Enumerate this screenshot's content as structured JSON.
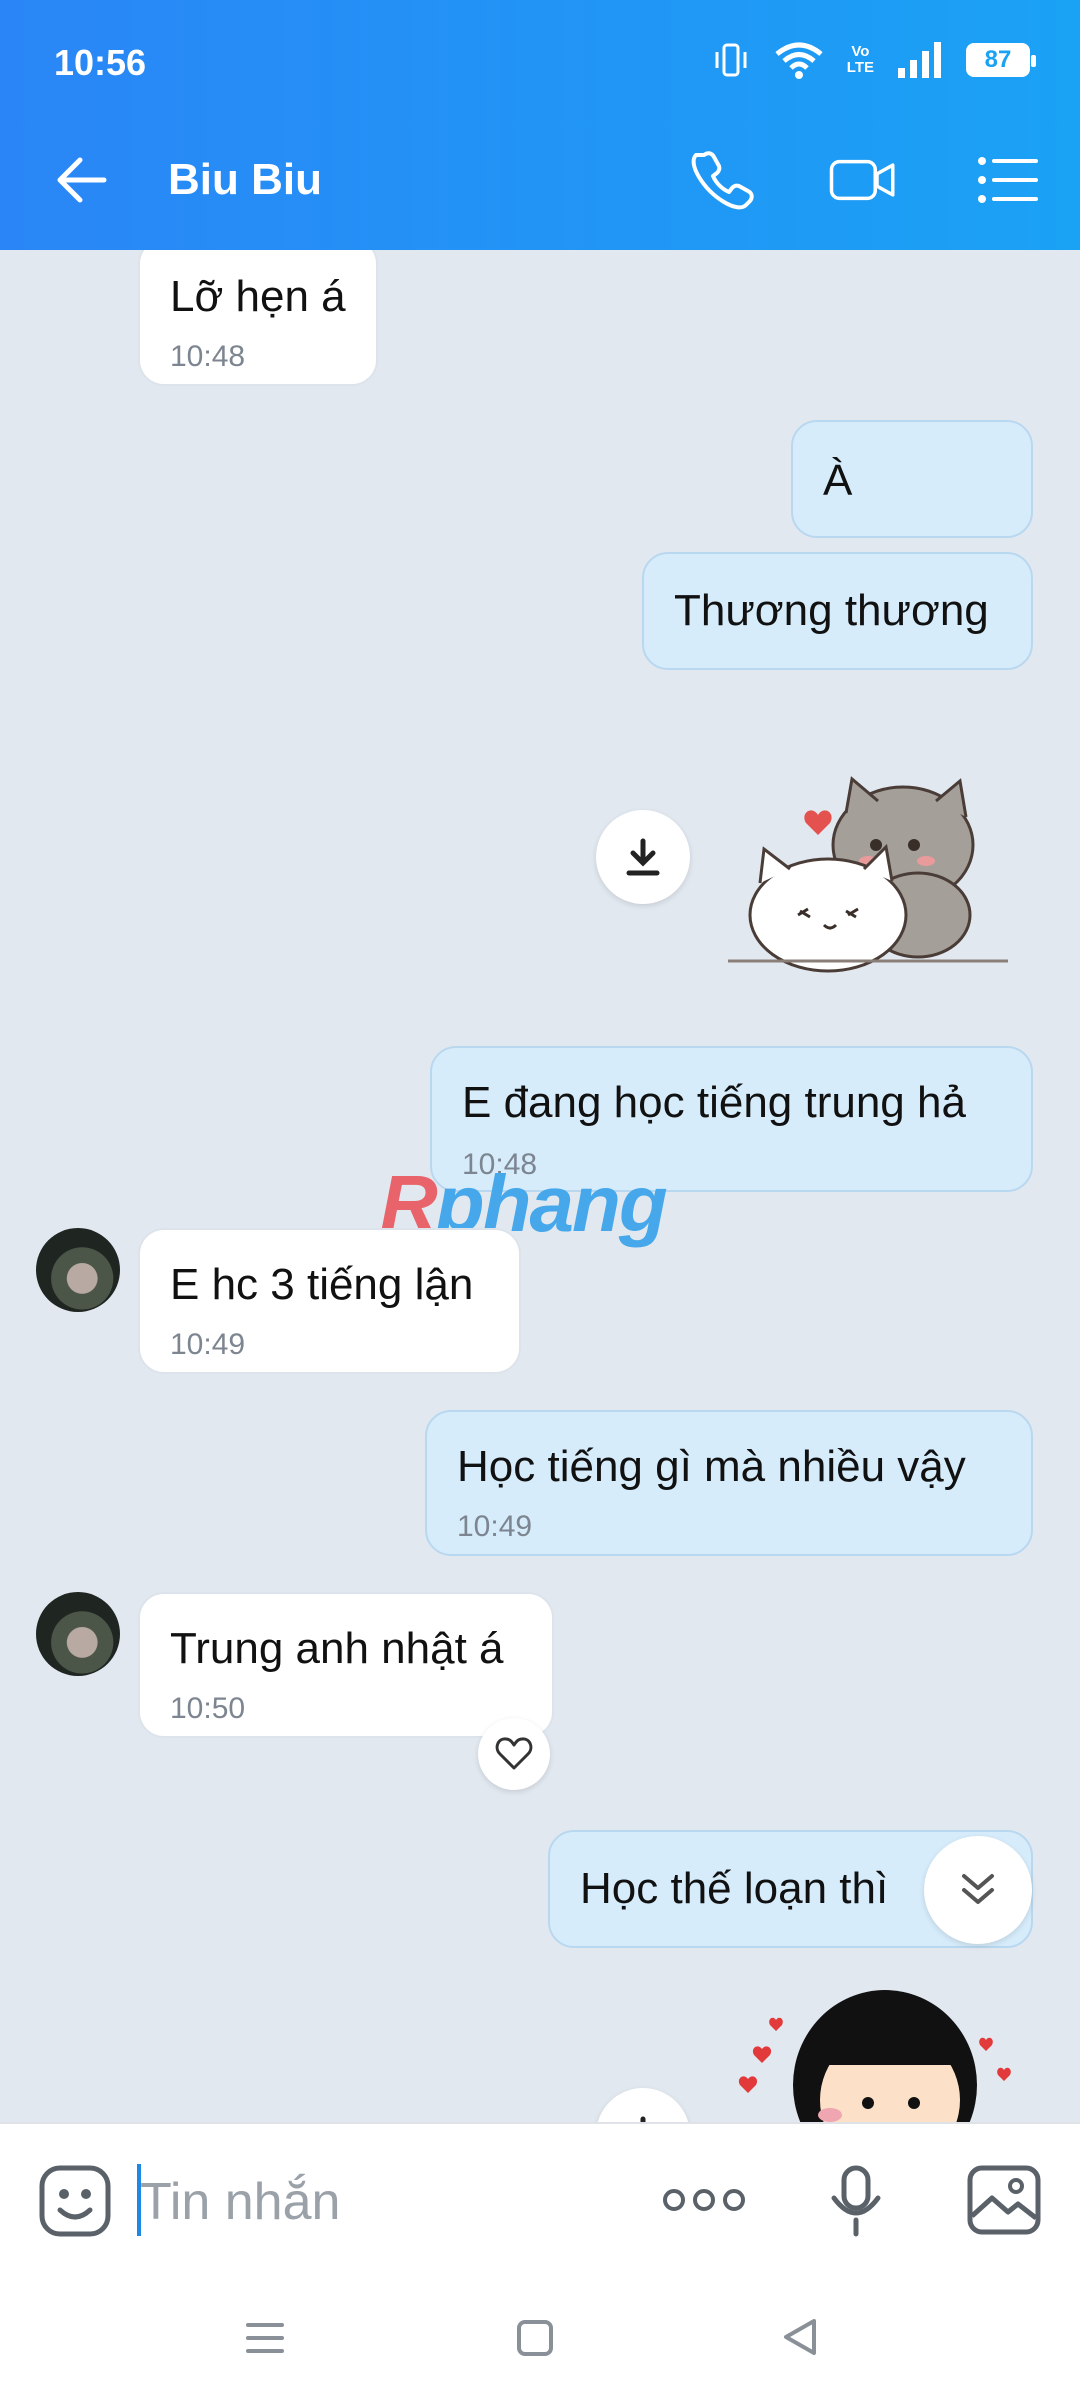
{
  "status": {
    "time": "10:56",
    "battery": "87",
    "volte_top": "Vo",
    "volte_bottom": "LTE"
  },
  "header": {
    "title": "Biu Biu"
  },
  "messages": [
    {
      "side": "received",
      "text": "Lỡ hẹn á",
      "time": "10:48"
    },
    {
      "side": "sent",
      "text": "À"
    },
    {
      "side": "sent",
      "text": "Thương thương"
    },
    {
      "side": "sent",
      "text": "E đang học tiếng trung hả",
      "time": "10:48"
    },
    {
      "side": "received",
      "text": "E hc 3 tiếng lận",
      "time": "10:49"
    },
    {
      "side": "sent",
      "text": "Học tiếng gì mà nhiều vậy",
      "time": "10:49"
    },
    {
      "side": "received",
      "text": "Trung anh nhật á",
      "time": "10:50"
    },
    {
      "side": "sent",
      "text": "Học thế loạn thì"
    }
  ],
  "watermark": {
    "part1": "R",
    "part2": "phang"
  },
  "composer": {
    "placeholder": "Tin nhắn"
  },
  "colors": {
    "header_start": "#2a86f6",
    "header_end": "#1aa2f5",
    "sent_bubble": "#d6ecfb",
    "received_bubble": "#ffffff",
    "chat_bg": "#e2e8f0"
  }
}
